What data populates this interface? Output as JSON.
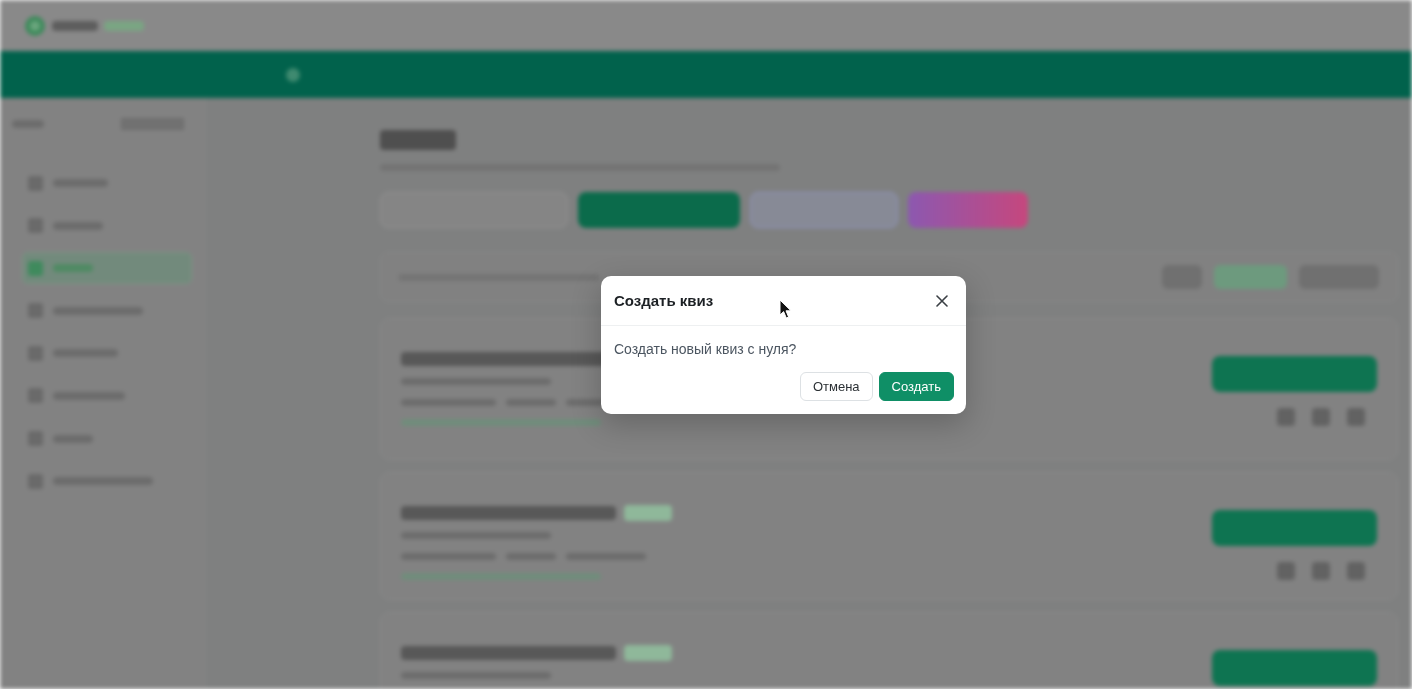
{
  "backdrop": {
    "sidebar": {
      "items": [
        {
          "selected": false
        },
        {
          "selected": false
        },
        {
          "selected": true
        },
        {
          "selected": false
        },
        {
          "selected": false
        },
        {
          "selected": false
        },
        {
          "selected": false
        },
        {
          "selected": false
        }
      ]
    },
    "actions": [
      {
        "kind": "outline"
      },
      {
        "kind": "primary"
      },
      {
        "kind": "accent"
      },
      {
        "kind": "gradient"
      }
    ],
    "filters": [
      {
        "selected": false
      },
      {
        "selected": true
      },
      {
        "selected": false
      }
    ],
    "cards": [
      {
        "badge": false
      },
      {
        "badge": true
      },
      {
        "badge": true
      }
    ]
  },
  "dialog": {
    "title": "Создать квиз",
    "message": "Создать новый квиз с нуля?",
    "buttons": [
      {
        "label": "Отмена",
        "kind": "secondary"
      },
      {
        "label": "Создать",
        "kind": "primary"
      }
    ]
  }
}
